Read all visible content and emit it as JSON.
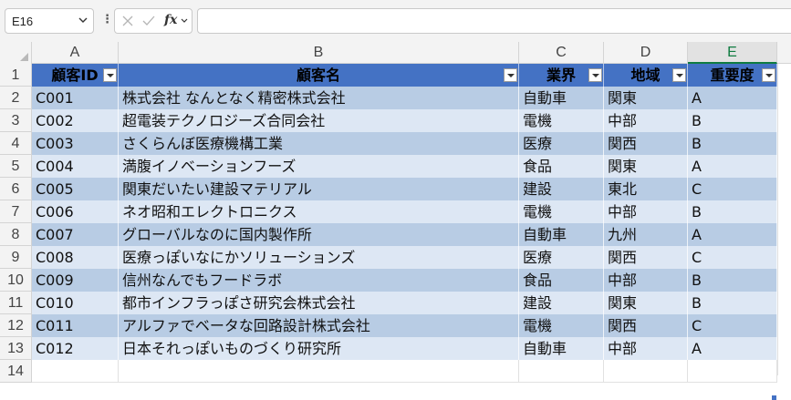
{
  "formula_bar": {
    "name_box": "E16",
    "menu_dots": "⋮",
    "cancel_icon": "cancel-icon",
    "enter_icon": "check-icon",
    "fx_label": "fx",
    "formula": ""
  },
  "columns": [
    "A",
    "B",
    "C",
    "D",
    "E"
  ],
  "selected_column": "E",
  "row_numbers": [
    "1",
    "2",
    "3",
    "4",
    "5",
    "6",
    "7",
    "8",
    "9",
    "10",
    "11",
    "12",
    "13",
    "14"
  ],
  "table": {
    "header_color": "#4472c4",
    "band_light": "#dde7f4",
    "band_dark": "#b8cce4",
    "headers": [
      "顧客ID",
      "顧客名",
      "業界",
      "地域",
      "重要度"
    ],
    "rows": [
      [
        "C001",
        "株式会社 なんとなく精密株式会社",
        "自動車",
        "関東",
        "A"
      ],
      [
        "C002",
        "超電装テクノロジーズ合同会社",
        "電機",
        "中部",
        "B"
      ],
      [
        "C003",
        "さくらんぼ医療機構工業",
        "医療",
        "関西",
        "B"
      ],
      [
        "C004",
        "満腹イノベーションフーズ",
        "食品",
        "関東",
        "A"
      ],
      [
        "C005",
        "関東だいたい建設マテリアル",
        "建設",
        "東北",
        "C"
      ],
      [
        "C006",
        "ネオ昭和エレクトロニクス",
        "電機",
        "中部",
        "B"
      ],
      [
        "C007",
        "グローバルなのに国内製作所",
        "自動車",
        "九州",
        "A"
      ],
      [
        "C008",
        "医療っぽいなにかソリューションズ",
        "医療",
        "関西",
        "C"
      ],
      [
        "C009",
        "信州なんでもフードラボ",
        "食品",
        "中部",
        "B"
      ],
      [
        "C010",
        "都市インフラっぽさ研究会株式会社",
        "建設",
        "関東",
        "B"
      ],
      [
        "C011",
        "アルファでベータな回路設計株式会社",
        "電機",
        "関西",
        "C"
      ],
      [
        "C012",
        "日本それっぽいものづくり研究所",
        "自動車",
        "中部",
        "A"
      ]
    ]
  }
}
